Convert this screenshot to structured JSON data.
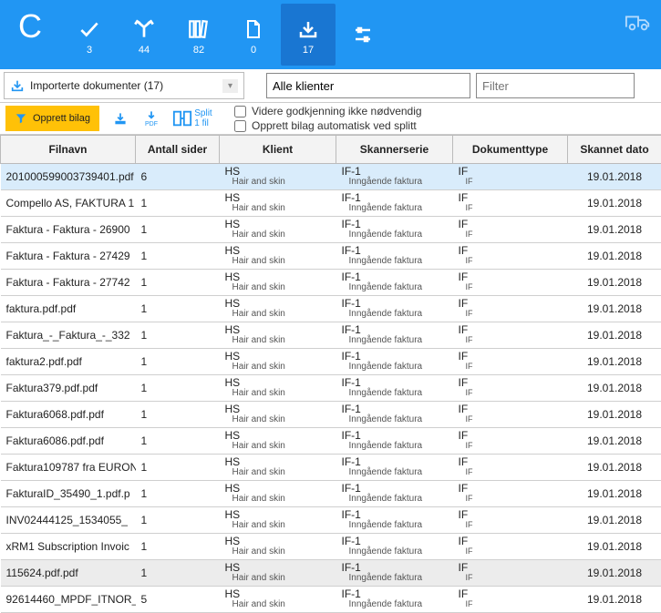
{
  "ribbon": {
    "logo": "C",
    "items": [
      {
        "name": "check-icon",
        "count": "3"
      },
      {
        "name": "branch-icon",
        "count": "44"
      },
      {
        "name": "books-icon",
        "count": "82"
      },
      {
        "name": "page-icon",
        "count": "0"
      },
      {
        "name": "download-icon",
        "count": "17",
        "active": true
      },
      {
        "name": "sliders-icon",
        "count": ""
      }
    ]
  },
  "filterbar": {
    "doclist_label": "Importerte dokumenter (17)",
    "clients_value": "Alle klienter",
    "filter_placeholder": "Filter"
  },
  "toolrow": {
    "create_label": "Opprett bilag",
    "split_label1": "Split",
    "split_label2": "1 fil",
    "chk1": "Videre godkjenning ikke nødvendig",
    "chk2": "Opprett bilag automatisk ved splitt"
  },
  "table": {
    "headers": {
      "file": "Filnavn",
      "pages": "Antall sider",
      "client": "Klient",
      "serie": "Skannerserie",
      "type": "Dokumenttype",
      "date": "Skannet dato"
    },
    "client_code": "HS",
    "client_name": "Hair and skin",
    "serie_code": "IF-1",
    "serie_name": "Inngående faktura",
    "type_code": "IF",
    "type_name": "IF",
    "rows": [
      {
        "file": "201000599003739401.pdf",
        "pages": "6",
        "date": "19.01.2018",
        "sel": true
      },
      {
        "file": "Compello AS, FAKTURA 1",
        "pages": "1",
        "date": "19.01.2018"
      },
      {
        "file": "Faktura - Faktura - 26900",
        "pages": "1",
        "date": "19.01.2018"
      },
      {
        "file": "Faktura - Faktura - 27429",
        "pages": "1",
        "date": "19.01.2018"
      },
      {
        "file": "Faktura - Faktura - 27742",
        "pages": "1",
        "date": "19.01.2018"
      },
      {
        "file": "faktura.pdf.pdf",
        "pages": "1",
        "date": "19.01.2018"
      },
      {
        "file": "Faktura_-_Faktura_-_332",
        "pages": "1",
        "date": "19.01.2018"
      },
      {
        "file": "faktura2.pdf.pdf",
        "pages": "1",
        "date": "19.01.2018"
      },
      {
        "file": "Faktura379.pdf.pdf",
        "pages": "1",
        "date": "19.01.2018"
      },
      {
        "file": "Faktura6068.pdf.pdf",
        "pages": "1",
        "date": "19.01.2018"
      },
      {
        "file": "Faktura6086.pdf.pdf",
        "pages": "1",
        "date": "19.01.2018"
      },
      {
        "file": "Faktura109787 fra EURON",
        "pages": "1",
        "date": "19.01.2018"
      },
      {
        "file": "FakturaID_35490_1.pdf.p",
        "pages": "1",
        "date": "19.01.2018"
      },
      {
        "file": "INV02444125_1534055_",
        "pages": "1",
        "date": "19.01.2018"
      },
      {
        "file": "xRM1 Subscription Invoic",
        "pages": "1",
        "date": "19.01.2018"
      },
      {
        "file": "115624.pdf.pdf",
        "pages": "1",
        "date": "19.01.2018",
        "alt": true
      },
      {
        "file": "92614460_MPDF_ITNOR_",
        "pages": "5",
        "date": "19.01.2018"
      }
    ]
  }
}
